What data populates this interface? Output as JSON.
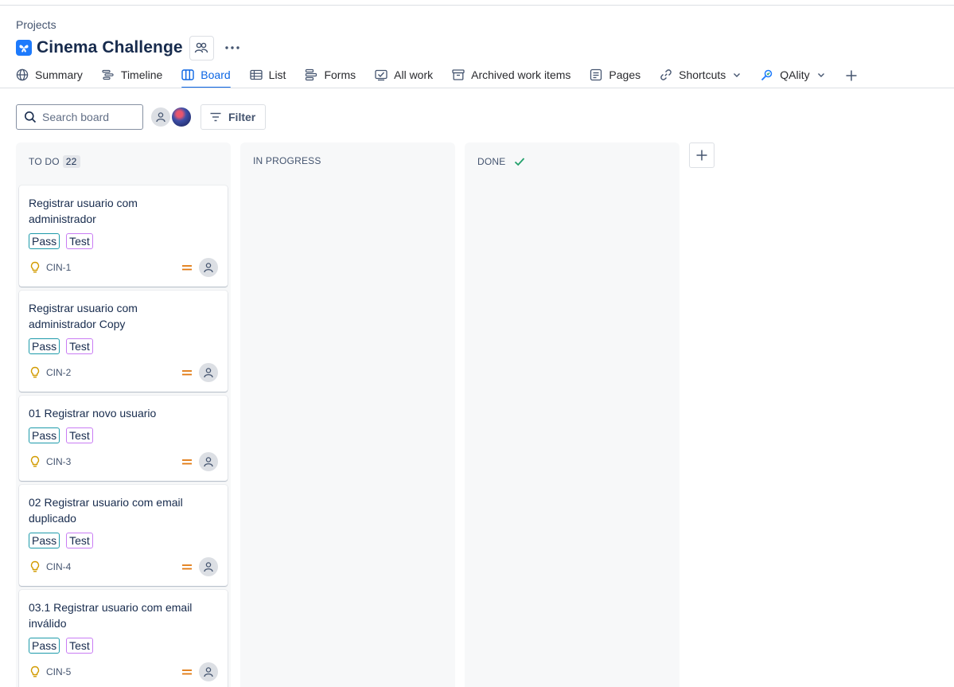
{
  "breadcrumb": "Projects",
  "project": {
    "title": "Cinema Challenge",
    "icon": "project-butterfly-icon",
    "accent": "#1d7afc"
  },
  "tabs": [
    {
      "label": "Summary",
      "icon": "globe-icon"
    },
    {
      "label": "Timeline",
      "icon": "timeline-icon"
    },
    {
      "label": "Board",
      "icon": "board-icon",
      "active": true
    },
    {
      "label": "List",
      "icon": "list-icon"
    },
    {
      "label": "Forms",
      "icon": "forms-icon"
    },
    {
      "label": "All work",
      "icon": "all-work-icon"
    },
    {
      "label": "Archived work items",
      "icon": "archive-icon"
    },
    {
      "label": "Pages",
      "icon": "pages-icon"
    },
    {
      "label": "Shortcuts",
      "icon": "link-icon"
    },
    {
      "label": "QAlity",
      "icon": "qality-icon"
    }
  ],
  "toolbar": {
    "search_placeholder": "Search board",
    "filter_label": "Filter"
  },
  "columns": [
    {
      "name": "TO DO",
      "count": "22"
    },
    {
      "name": "IN PROGRESS"
    },
    {
      "name": "DONE"
    }
  ],
  "cards": [
    {
      "title": "Registrar usuario com administrador",
      "labels": [
        "Pass",
        "Test"
      ],
      "key": "CIN-1"
    },
    {
      "title": "Registrar usuario com administrador Copy",
      "labels": [
        "Pass",
        "Test"
      ],
      "key": "CIN-2"
    },
    {
      "title": "01 Registrar novo usuario",
      "labels": [
        "Pass",
        "Test"
      ],
      "key": "CIN-3"
    },
    {
      "title": "02 Registrar usuario com email duplicado",
      "labels": [
        "Pass",
        "Test"
      ],
      "key": "CIN-4"
    },
    {
      "title": "03.1 Registrar usuario com email inválido",
      "labels": [
        "Pass",
        "Test"
      ],
      "key": "CIN-5"
    }
  ],
  "colors": {
    "active_tab": "#0c66e4",
    "label_pass_border": "#1d9aaa",
    "label_test_border": "#c97cf4",
    "priority_medium": "#e2780f",
    "idea_icon": "#d29b00",
    "done_check": "#22a06b"
  }
}
